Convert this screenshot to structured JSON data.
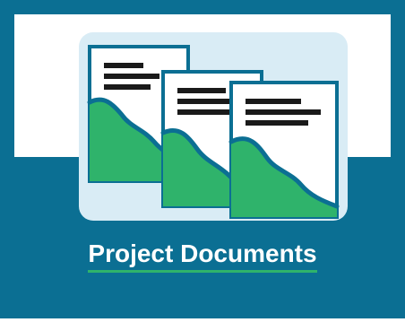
{
  "tile": {
    "title": "Project Documents",
    "icon": "stacked-documents-with-river-icon"
  },
  "colors": {
    "frame_blue": "#0b6f93",
    "panel_light_blue": "#d9ecf5",
    "doc_border": "#0b6f93",
    "hill_green": "#2fb36b",
    "river_stroke": "#0b6f93",
    "text_black": "#1a1a1a",
    "underline_green": "#2fb36b"
  }
}
